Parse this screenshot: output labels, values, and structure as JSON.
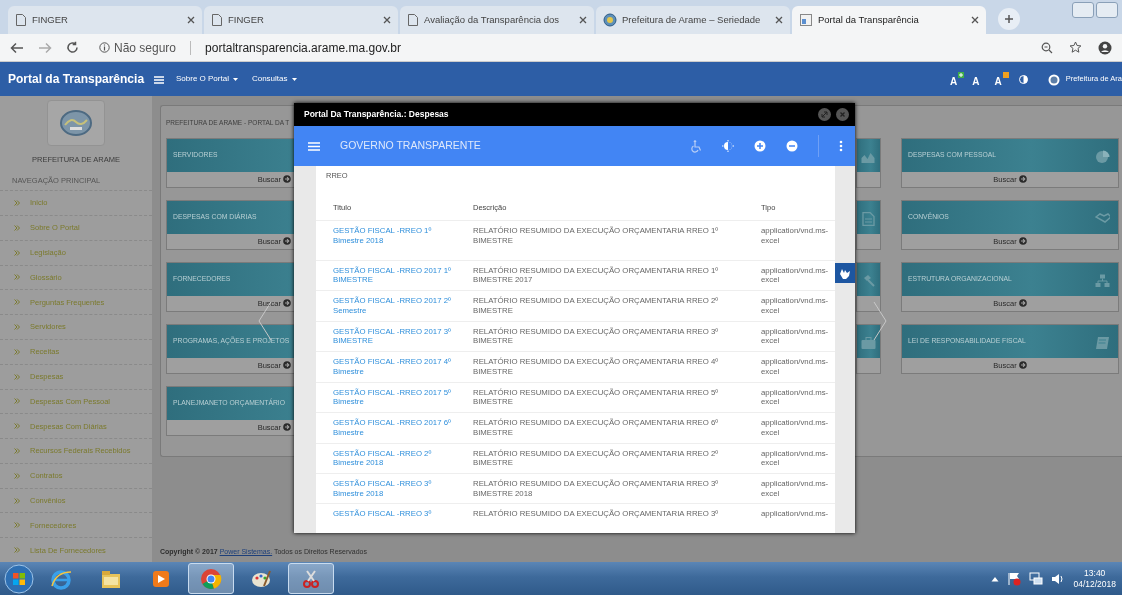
{
  "browser": {
    "tabs": [
      {
        "title": "FINGER",
        "kind": "page",
        "selected": false
      },
      {
        "title": "FINGER",
        "kind": "page",
        "selected": false
      },
      {
        "title": "Avaliação da Transparência dos",
        "kind": "page",
        "selected": false
      },
      {
        "title": "Prefeitura de Arame – Seriedade",
        "kind": "logo",
        "selected": false
      },
      {
        "title": "Portal da Transparência",
        "kind": "portal",
        "selected": true
      }
    ],
    "security": "Não seguro",
    "url": "portaltransparencia.arame.ma.gov.br"
  },
  "navbar": {
    "brand": "Portal da Transparência",
    "menus": [
      "Sobre O Portal",
      "Consultas"
    ],
    "font_controls": [
      {
        "label": "A",
        "kind": "increase"
      },
      {
        "label": "A",
        "kind": "normal"
      },
      {
        "label": "A",
        "kind": "decrease"
      }
    ],
    "user": "Prefeitura de Ara"
  },
  "sidebar": {
    "org": "PREFEITURA DE ARAME",
    "section": "NAVEGAÇÃO PRINCIPAL",
    "items": [
      "Inicio",
      "Sobre O Portal",
      "Legislação",
      "Glossário",
      "Perguntas Frequentes",
      "Servidores",
      "Receitas",
      "Despesas",
      "Despesas Com Pessoal",
      "Despesas Com Diárias",
      "Recursos Federais Recebidos",
      "Contratos",
      "Convênios",
      "Fornecedores",
      "Lista De Fornecedores"
    ]
  },
  "panel": {
    "title": "PREFEITURA DE ARAME - PORTAL DA T",
    "left_cards": [
      {
        "title": "SERVIDORES",
        "button": "Buscar"
      },
      {
        "title": "DESPESAS COM DIÁRIAS",
        "button": "Buscar"
      },
      {
        "title": "FORNECEDORES",
        "button": "Buscar"
      },
      {
        "title": "PROGRAMAS, AÇÕES E PROJETOS",
        "button": "Buscar"
      },
      {
        "title": "PLANEJMANETO ORÇAMENTÁRIO",
        "button": "Buscar"
      }
    ],
    "right_cards": [
      {
        "title": "DESPESAS COM PESSOAL",
        "button": "Buscar",
        "kind": "pie"
      },
      {
        "title": "CONVÊNIOS",
        "button": "Buscar",
        "kind": "handshake"
      },
      {
        "title": "ESTRUTURA ORGANIZACIONAL",
        "button": "Buscar",
        "kind": "sitemap"
      },
      {
        "title": "LEI DE RESPONSABILIDADE FISCAL",
        "button": "Buscar",
        "kind": "book"
      }
    ]
  },
  "modal": {
    "title": "Portal Da Transparência.: Despesas",
    "toolbar_title": "GOVERNO TRANSPARENTE",
    "section": "RREO",
    "columns": [
      "Titulo",
      "Descrição",
      "Tipo"
    ],
    "rows": [
      {
        "title": "GESTÃO FISCAL -RREO 1º Bimestre 2018",
        "description": "RELATÓRIO RESUMIDO DA EXECUÇÃO ORÇAMENTARIA RREO 1º BIMESTRE",
        "type": "application/vnd.ms-excel"
      },
      {
        "title": "GESTÃO FISCAL -RREO 2017 1º BIMESTRE",
        "description": "RELATÓRIO RESUMIDO DA EXECUÇÃO ORÇAMENTARIA RREO 1º BIMESTRE 2017",
        "type": "application/vnd.ms-excel"
      },
      {
        "title": "GESTÃO FISCAL -RREO 2017 2º Semestre",
        "description": "RELATÓRIO RESUMIDO DA EXECUÇÃO ORÇAMENTARIA RREO 2º BIMESTRE",
        "type": "application/vnd.ms-excel"
      },
      {
        "title": "GESTÃO FISCAL -RREO 2017 3º BIMESTRE",
        "description": "RELATÓRIO RESUMIDO DA EXECUÇÃO ORÇAMENTARIA RREO 3º BIMESTRE",
        "type": "application/vnd.ms-excel"
      },
      {
        "title": "GESTÃO FISCAL -RREO 2017 4º Bimestre",
        "description": "RELATÓRIO RESUMIDO DA EXECUÇÃO ORÇAMENTARIA RREO 4º BIMESTRE",
        "type": "application/vnd.ms-excel"
      },
      {
        "title": "GESTÃO FISCAL -RREO 2017 5º Bimestre",
        "description": "RELATÓRIO RESUMIDO DA EXECUÇÃO ORÇAMENTARIA RREO 5º BIMESTRE",
        "type": "application/vnd.ms-excel"
      },
      {
        "title": "GESTÃO FISCAL -RREO 2017 6º Bimestre",
        "description": "RELATÓRIO RESUMIDO DA EXECUÇÃO ORÇAMENTARIA RREO 6º BIMESTRE",
        "type": "application/vnd.ms-excel"
      },
      {
        "title": "GESTÃO FISCAL -RREO 2º Bimestre 2018",
        "description": "RELATÓRIO RESUMIDO DA EXECUÇÃO ORÇAMENTARIA RREO 2º BIMESTRE",
        "type": "application/vnd.ms-excel"
      },
      {
        "title": "GESTÃO FISCAL -RREO 3º Bimestre 2018",
        "description": "RELATÓRIO RESUMIDO DA EXECUÇÃO ORÇAMENTARIA RREO 3º BIMESTRE 2018",
        "type": "application/vnd.ms-excel"
      },
      {
        "title": "GESTÃO FISCAL -RREO 3º",
        "description": "RELATÓRIO RESUMIDO DA EXECUÇÃO ORÇAMENTARIA RREO 3º",
        "type": "application/vnd.ms-"
      }
    ]
  },
  "footer": {
    "copyright": "Copyright © 2017",
    "company": "Power Sistemas.",
    "rights": "Todos os Direitos Reservados"
  },
  "taskbar": {
    "apps": [
      {
        "kind": "ie",
        "selected": false
      },
      {
        "kind": "explorer",
        "selected": false
      },
      {
        "kind": "media",
        "selected": false
      },
      {
        "kind": "chrome",
        "selected": true
      },
      {
        "kind": "paint",
        "selected": false
      },
      {
        "kind": "snipping",
        "selected": true
      }
    ],
    "time": "13:40",
    "date": "04/12/2018"
  }
}
